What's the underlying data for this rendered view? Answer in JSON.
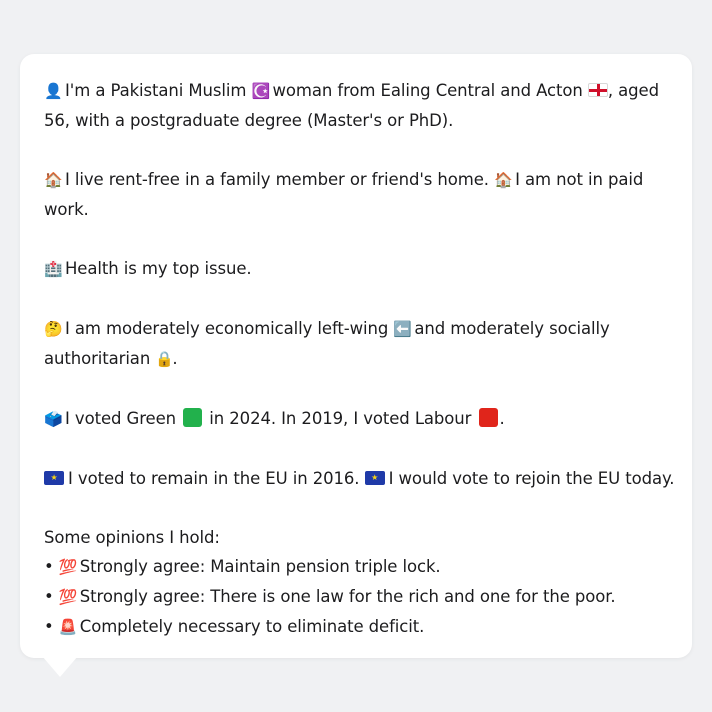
{
  "colors": {
    "green_square": "#22b14c",
    "red_square": "#e0251b",
    "eu_blue": "#1f3aa8",
    "eng_red": "#d0102b"
  },
  "icons": {
    "person": "person-silhouette-icon",
    "religion": "star-and-crescent-icon",
    "england_flag": "england-flag-icon",
    "house": "house-icon",
    "hospital": "hospital-icon",
    "thinking": "thinking-face-icon",
    "left_arrow": "left-arrow-icon",
    "lock": "lock-icon",
    "ballot": "ballot-box-icon",
    "eu_flag": "eu-flag-icon",
    "hundred": "hundred-points-icon",
    "siren": "police-light-icon"
  },
  "profile": {
    "p1_a": "I'm a Pakistani Muslim",
    "p1_b": "woman from Ealing Central and Acton",
    "p1_c": ", aged",
    "p1_d": "56, with a postgraduate degree (Master's or PhD).",
    "p2_a": "I live rent-free in a family member or friend's home.",
    "p2_b": "I am not in paid",
    "p2_c": "work.",
    "p3": "Health is my top issue.",
    "p4_a": "I am moderately economically left-wing",
    "p4_b": "and moderately socially",
    "p4_c": "authoritarian",
    "p4_d": ".",
    "p5_a": "I voted Green",
    "p5_b": "in 2024. In 2019, I voted Labour",
    "p5_c": ".",
    "p6_a": "I voted to remain in the EU in 2016.",
    "p6_b": "I would vote to rejoin the EU today."
  },
  "opinions": {
    "heading": "Some opinions I hold:",
    "bullet": "•",
    "items": [
      "Strongly agree: Maintain pension triple lock.",
      "Strongly agree: There is one law for the rich and one for the poor.",
      "Completely necessary to eliminate deficit."
    ]
  }
}
